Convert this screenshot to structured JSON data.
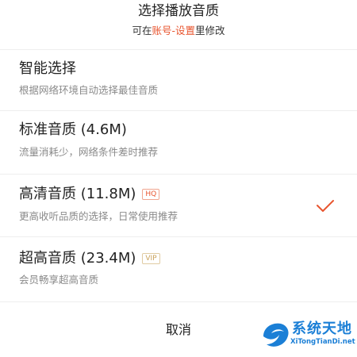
{
  "header": {
    "title": "选择播放音质",
    "subtitle_prefix": "可在",
    "subtitle_link": "账号-设置",
    "subtitle_suffix": "里修改"
  },
  "options": [
    {
      "title": "智能选择",
      "desc": "根据网络环境自动选择最佳音质",
      "badge": "",
      "selected": false
    },
    {
      "title": "标准音质 (4.6M)",
      "desc": "流量消耗少，网络条件差时推荐",
      "badge": "",
      "selected": false
    },
    {
      "title": "高清音质 (11.8M)",
      "desc": "更高收听品质的选择，日常使用推荐",
      "badge": "HQ",
      "selected": true
    },
    {
      "title": "超高音质 (23.4M)",
      "desc": "会员畅享超高音质",
      "badge": "VIP",
      "selected": false
    }
  ],
  "cancel_label": "取消",
  "watermark": {
    "name": "系统天地",
    "url": "XiTongTianDi.net"
  },
  "colors": {
    "accent": "#e8552f",
    "vip": "#c9a25b",
    "watermark": "#1b7fd6"
  },
  "icons": {
    "selected": "checkmark-icon"
  }
}
